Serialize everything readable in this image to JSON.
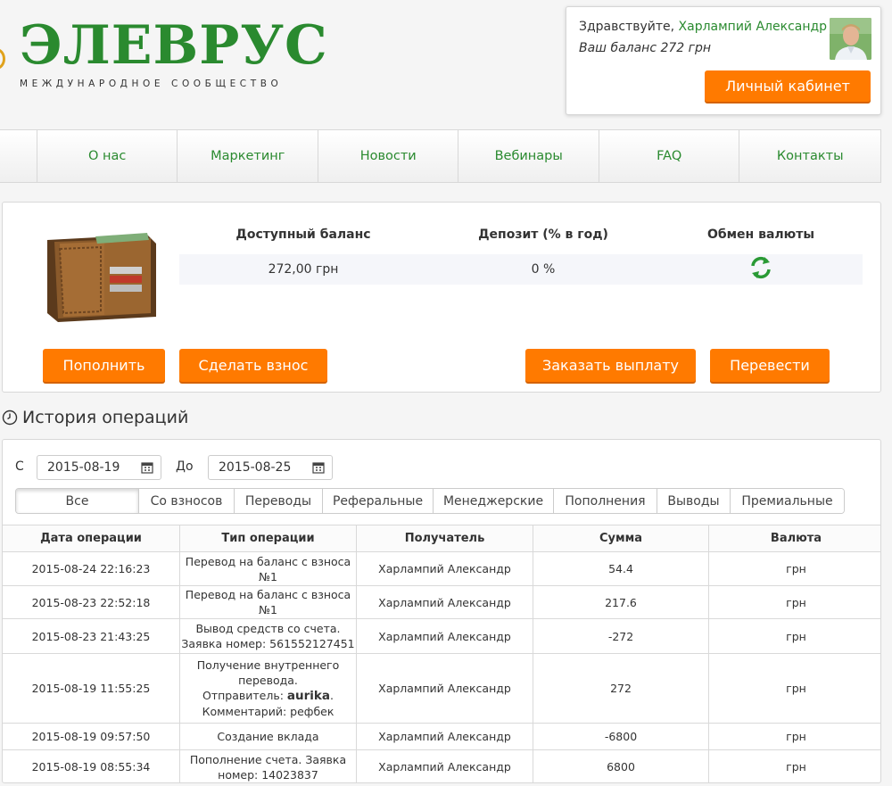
{
  "header": {
    "logo_title": "ЭЛЕВРУС",
    "logo_subtitle": "МЕЖДУНАРОДНОЕ СООБЩЕСТВО",
    "greeting": "Здравствуйте,",
    "user_name": "Харлампий Александр",
    "balance_text": "Ваш баланс 272 грн",
    "cabinet_button": "Личный кабинет"
  },
  "nav": {
    "items": [
      "О нас",
      "Маркетинг",
      "Новости",
      "Вебинары",
      "FAQ",
      "Контакты"
    ]
  },
  "wallet": {
    "available_label": "Доступный баланс",
    "deposit_label": "Депозит (% в год)",
    "exchange_label": "Обмен валюты",
    "available_value": "272,00 грн",
    "deposit_value": "0 %",
    "buttons": {
      "topup": "Пополнить",
      "contribute": "Сделать взнос",
      "payout": "Заказать выплату",
      "transfer": "Перевести"
    }
  },
  "history": {
    "title": "История операций",
    "from_label": "С",
    "from_date": "2015-08-19",
    "to_label": "До",
    "to_date": "2015-08-25",
    "tabs": [
      "Все",
      "Со взносов",
      "Переводы",
      "Реферальные",
      "Менеджерские",
      "Пополнения",
      "Выводы",
      "Премиальные"
    ],
    "active_tab": "Все",
    "columns": [
      "Дата операции",
      "Тип операции",
      "Получатель",
      "Сумма",
      "Валюта"
    ],
    "rows": [
      {
        "date": "2015-08-24 22:16:23",
        "type_lines": [
          "Перевод на баланс с взноса",
          "№1"
        ],
        "recipient": "Харлампий Александр",
        "amount": "54.4",
        "currency": "грн"
      },
      {
        "date": "2015-08-23 22:52:18",
        "type_lines": [
          "Перевод на баланс с взноса",
          "№1"
        ],
        "recipient": "Харлампий Александр",
        "amount": "217.6",
        "currency": "грн"
      },
      {
        "date": "2015-08-23 21:43:25",
        "type_lines": [
          "Вывод средств со счета.",
          "Заявка номер: 561552127451"
        ],
        "recipient": "Харлампий Александр",
        "amount": "-272",
        "currency": "грн"
      },
      {
        "date": "2015-08-19 11:55:25",
        "type_lines": [
          "Получение внутреннего",
          "перевода.",
          "Отправитель: ",
          "aurika",
          ".",
          "Комментарий: рефбек"
        ],
        "recipient": "Харлампий Александр",
        "amount": "272",
        "currency": "грн"
      },
      {
        "date": "2015-08-19 09:57:50",
        "type_lines": [
          "Создание вклада"
        ],
        "recipient": "Харлампий Александр",
        "amount": "-6800",
        "currency": "грн"
      },
      {
        "date": "2015-08-19 08:55:34",
        "type_lines": [
          "Пополнение счета. Заявка",
          "номер: 14023837"
        ],
        "recipient": "Харлампий Александр",
        "amount": "6800",
        "currency": "грн"
      }
    ]
  },
  "colors": {
    "brand_green": "#2a8a2f",
    "accent_orange": "#ff7a00"
  }
}
